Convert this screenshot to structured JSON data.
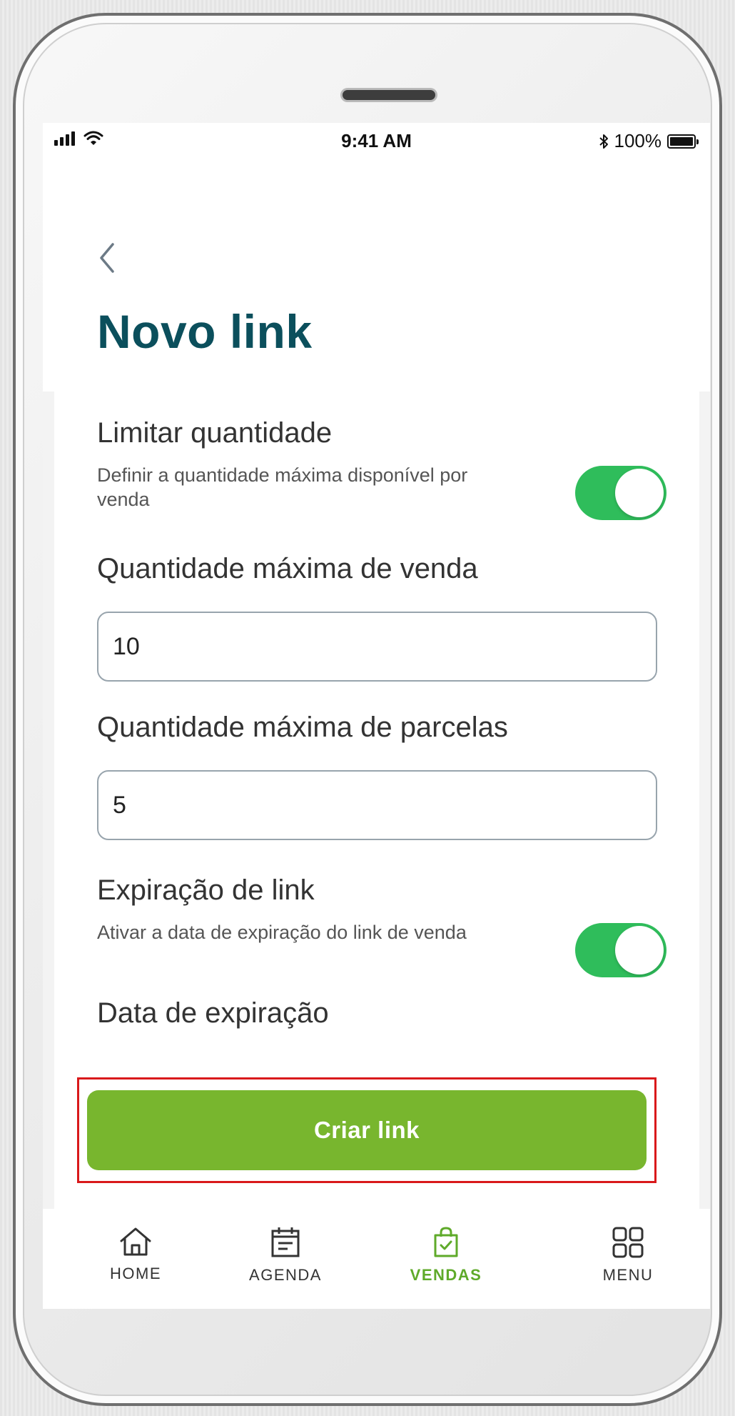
{
  "status_bar": {
    "time": "9:41 AM",
    "battery": "100%"
  },
  "header": {
    "title": "Novo link"
  },
  "limit_quantity": {
    "title": "Limitar quantidade",
    "description": "Definir a quantidade máxima disponível por venda",
    "enabled": true
  },
  "max_sale_quantity": {
    "label": "Quantidade máxima de venda",
    "value": "10"
  },
  "max_installments": {
    "label": "Quantidade máxima de parcelas",
    "value": "5"
  },
  "link_expiration": {
    "title": "Expiração de link",
    "description": "Ativar a data de expiração do link de venda",
    "enabled": true
  },
  "expiration_date": {
    "label": "Data de expiração"
  },
  "create_button": {
    "label": "Criar link"
  },
  "bottom_nav": {
    "items": [
      {
        "label": "HOME",
        "icon": "home-icon",
        "active": false
      },
      {
        "label": "AGENDA",
        "icon": "calendar-icon",
        "active": false
      },
      {
        "label": "VENDAS",
        "icon": "shopping-bag-icon",
        "active": true
      },
      {
        "label": "MENU",
        "icon": "grid-icon",
        "active": false
      }
    ]
  },
  "colors": {
    "title": "#0b4f5c",
    "toggle_on": "#2fbd5b",
    "primary_button": "#78b62e",
    "active_nav": "#5faa2a",
    "highlight": "#d9191b"
  }
}
